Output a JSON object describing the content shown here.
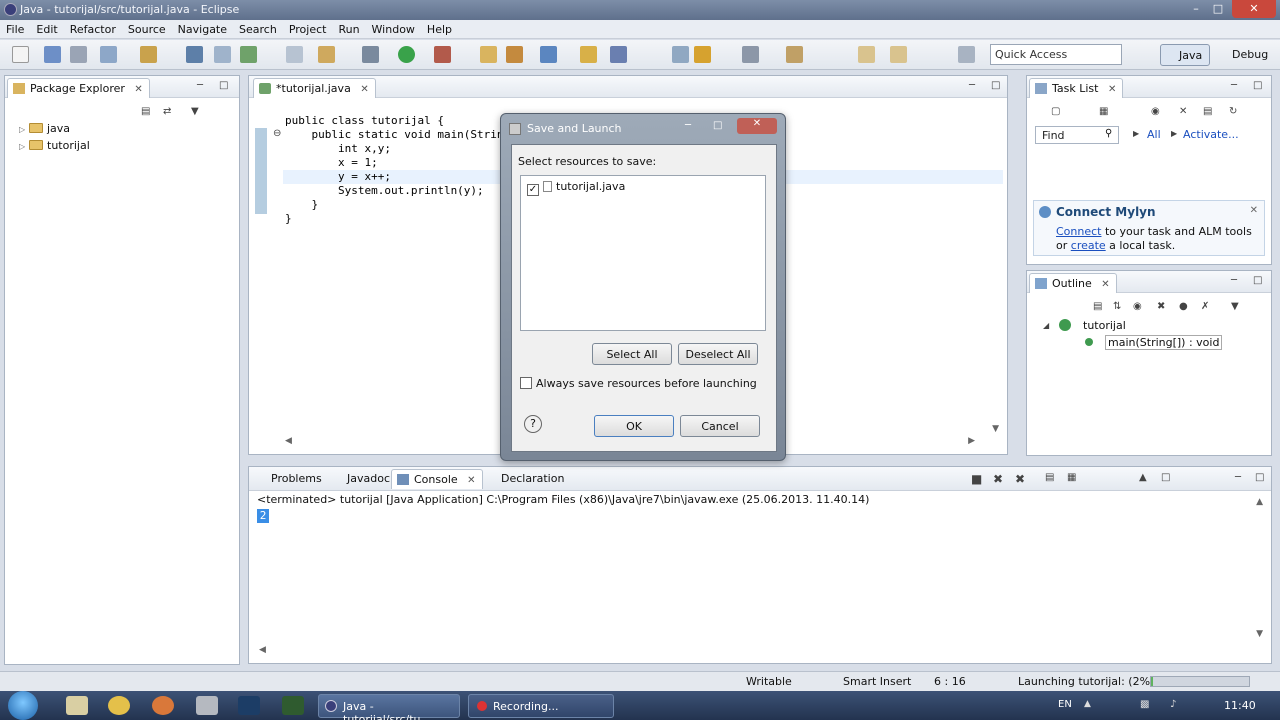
{
  "window": {
    "title": "Java - tutorijal/src/tutorijal.java - Eclipse"
  },
  "menu": [
    "File",
    "Edit",
    "Refactor",
    "Source",
    "Navigate",
    "Search",
    "Project",
    "Run",
    "Window",
    "Help"
  ],
  "toolbar": {
    "quick_access_placeholder": "Quick Access",
    "perspective_java": "Java",
    "perspective_debug": "Debug"
  },
  "package_explorer": {
    "tab": "Package Explorer",
    "items": [
      {
        "label": "java"
      },
      {
        "label": "tutorijal"
      }
    ]
  },
  "editor": {
    "tab": "*tutorijal.java",
    "code": "public class tutorijal {\n    public static void main(String[] args) {\n        int x,y;\n        x = 1;\n        y = x++;\n        System.out.println(y);\n    }\n}"
  },
  "task_list": {
    "tab": "Task List",
    "find_placeholder": "Find",
    "all": "All",
    "activate": "Activate...",
    "mylyn_title": "Connect Mylyn",
    "mylyn_connect": "Connect",
    "mylyn_text1": " to your task and ALM tools or",
    "mylyn_create": "create",
    "mylyn_text2": " a local task."
  },
  "outline": {
    "tab": "Outline",
    "class_name": "tutorijal",
    "method": "main(String[]) : void"
  },
  "console": {
    "tabs": [
      "Problems",
      "Javadoc",
      "Console",
      "Declaration"
    ],
    "status": "<terminated> tutorijal [Java Application] C:\\Program Files (x86)\\Java\\jre7\\bin\\javaw.exe (25.06.2013. 11.40.14)",
    "output": "2"
  },
  "statusbar": {
    "writable": "Writable",
    "insert_mode": "Smart Insert",
    "position": "6 : 16",
    "launch": "Launching tutorijal: (2%)",
    "progress_fraction": 0.02
  },
  "dialog": {
    "title": "Save and Launch",
    "label": "Select resources to save:",
    "resource": "tutorijal.java",
    "select_all": "Select All",
    "deselect_all": "Deselect All",
    "always_save": "Always save resources before launching",
    "ok": "OK",
    "cancel": "Cancel"
  },
  "taskbar": {
    "tasks": [
      "Java - tutorijal/src/tu...",
      "Recording..."
    ],
    "lang": "EN",
    "clock": "11:40"
  }
}
